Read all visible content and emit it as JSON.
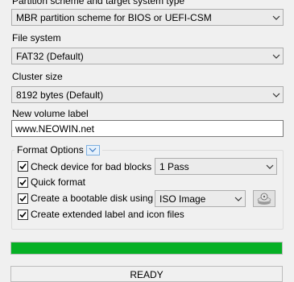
{
  "partition_scheme": {
    "label": "Partition scheme and target system type",
    "value": "MBR partition scheme for BIOS or UEFI-CSM"
  },
  "file_system": {
    "label": "File system",
    "value": "FAT32 (Default)"
  },
  "cluster_size": {
    "label": "Cluster size",
    "value": "8192 bytes (Default)"
  },
  "volume_label": {
    "label": "New volume label",
    "value": "www.NEOWIN.net"
  },
  "format_options": {
    "title": "Format Options",
    "bad_blocks": {
      "label": "Check device for bad blocks",
      "checked": true,
      "passes": "1 Pass"
    },
    "quick_format": {
      "label": "Quick format",
      "checked": true
    },
    "bootable": {
      "label": "Create a bootable disk using",
      "checked": true,
      "source": "ISO Image"
    },
    "extended_label": {
      "label": "Create extended label and icon files",
      "checked": true
    }
  },
  "progress": {
    "fraction": 1.0,
    "color": "#06b025"
  },
  "status": {
    "text": "READY"
  },
  "icons": [
    "chevron-down-icon",
    "expand-toggle-icon",
    "check-icon",
    "disk-image-icon"
  ]
}
